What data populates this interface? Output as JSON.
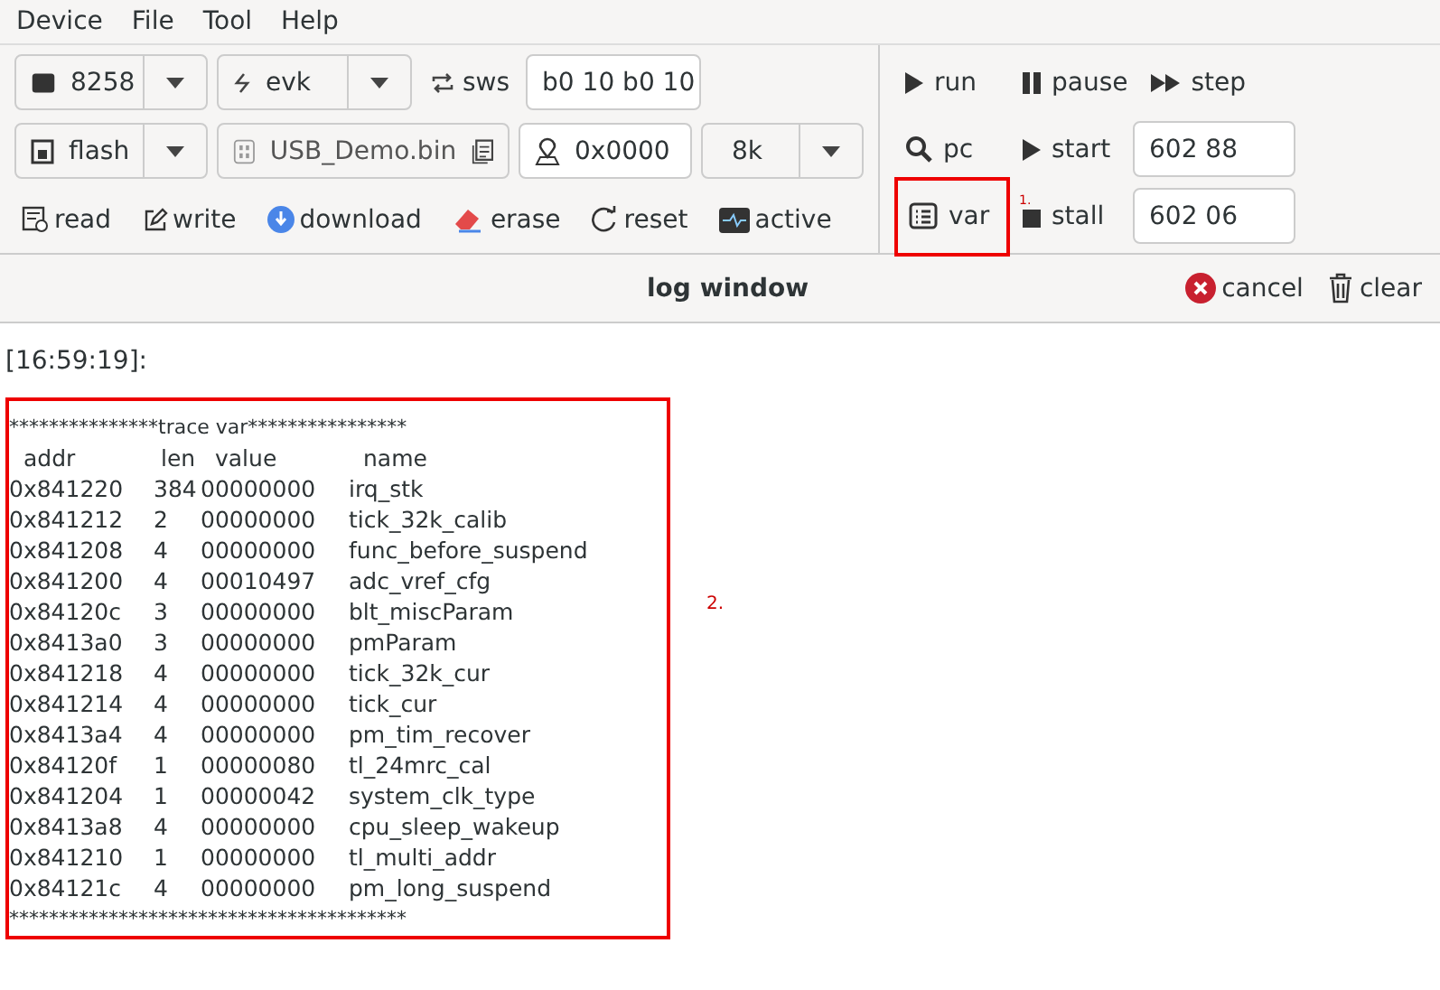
{
  "menu": [
    "Device",
    "File",
    "Tool",
    "Help"
  ],
  "toolbar": {
    "chip_select": {
      "value": "8258"
    },
    "link_select": {
      "value": "evk"
    },
    "sws_button": "sws",
    "sws_field": {
      "value": "b0 10 b0 10"
    },
    "memory_select": {
      "value": "flash"
    },
    "file_field": {
      "value": "USB_Demo.bin"
    },
    "address_field": {
      "value": "0x0000"
    },
    "size_select": {
      "value": "8k"
    },
    "actions": [
      {
        "kind": "read",
        "label": "read"
      },
      {
        "kind": "write",
        "label": "write"
      },
      {
        "kind": "download",
        "label": "download"
      },
      {
        "kind": "erase",
        "label": "erase"
      },
      {
        "kind": "reset",
        "label": "reset"
      },
      {
        "kind": "active",
        "label": "active"
      }
    ]
  },
  "debug": {
    "run": "run",
    "pause": "pause",
    "step": "step",
    "pc": "pc",
    "start": "start",
    "start_field": {
      "value": "602 88"
    },
    "var": {
      "label": "var",
      "highlighted": true
    },
    "stall": "stall",
    "stall_field": {
      "value": "602 06"
    },
    "annotation": "1."
  },
  "log_header": {
    "title": "log window",
    "cancel": "cancel",
    "clear": "clear"
  },
  "log": {
    "timestamp": "[16:59:19]:",
    "highlighted": true,
    "annotation": "2.",
    "banner": "***************trace var****************",
    "columns": [
      "addr",
      "len",
      "value",
      "name"
    ],
    "rows": [
      [
        "0x841220",
        "384",
        "00000000",
        "irq_stk"
      ],
      [
        "0x841212",
        "2",
        "00000000",
        "tick_32k_calib"
      ],
      [
        "0x841208",
        "4",
        "00000000",
        "func_before_suspend"
      ],
      [
        "0x841200",
        "4",
        "00010497",
        "adc_vref_cfg"
      ],
      [
        "0x84120c",
        "3",
        "00000000",
        "blt_miscParam"
      ],
      [
        "0x8413a0",
        "3",
        "00000000",
        "pmParam"
      ],
      [
        "0x841218",
        "4",
        "00000000",
        "tick_32k_cur"
      ],
      [
        "0x841214",
        "4",
        "00000000",
        "tick_cur"
      ],
      [
        "0x8413a4",
        "4",
        "00000000",
        "pm_tim_recover"
      ],
      [
        "0x84120f",
        "1",
        "00000080",
        "tl_24mrc_cal"
      ],
      [
        "0x841204",
        "1",
        "00000042",
        "system_clk_type"
      ],
      [
        "0x8413a8",
        "4",
        "00000000",
        "cpu_sleep_wakeup"
      ],
      [
        "0x841210",
        "1",
        "00000000",
        "tl_multi_addr"
      ],
      [
        "0x84121c",
        "4",
        "00000000",
        "pm_long_suspend"
      ]
    ],
    "footer": "****************************************"
  }
}
